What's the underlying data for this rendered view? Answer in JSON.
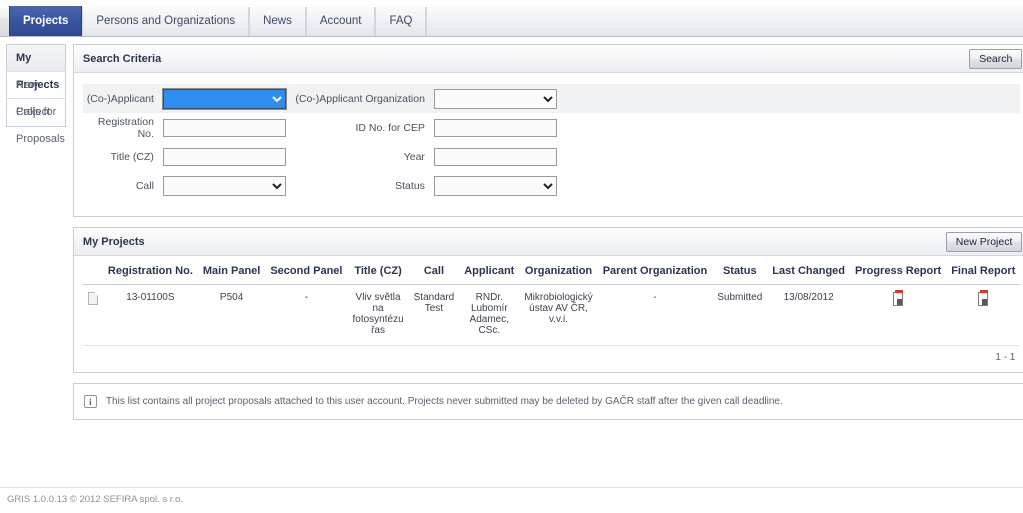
{
  "nav": {
    "tabs": [
      {
        "label": "Projects",
        "active": true
      },
      {
        "label": "Persons and Organizations",
        "active": false
      },
      {
        "label": "News",
        "active": false
      },
      {
        "label": "Account",
        "active": false
      },
      {
        "label": "FAQ",
        "active": false
      }
    ]
  },
  "sidebar": {
    "items": [
      {
        "label": "My Projects",
        "current": true
      },
      {
        "label": "New Project",
        "current": false
      },
      {
        "label": "Calls for Proposals",
        "current": false
      }
    ]
  },
  "search_panel": {
    "title": "Search Criteria",
    "search_button": "Search",
    "fields": {
      "applicant": {
        "label": "(Co-)Applicant",
        "value": "",
        "type": "select"
      },
      "applicant_org": {
        "label": "(Co-)Applicant Organization",
        "value": "",
        "type": "select"
      },
      "registration_no": {
        "label": "Registration No.",
        "value": "",
        "placeholder": ""
      },
      "id_no_cep": {
        "label": "ID No. for CEP",
        "value": "",
        "placeholder": ""
      },
      "title_cz": {
        "label": "Title (CZ)",
        "value": "",
        "placeholder": ""
      },
      "year": {
        "label": "Year",
        "value": "",
        "placeholder": ""
      },
      "call": {
        "label": "Call",
        "value": "",
        "type": "select"
      },
      "status": {
        "label": "Status",
        "value": "",
        "type": "select"
      }
    }
  },
  "projects_panel": {
    "title": "My Projects",
    "new_project_button": "New Project",
    "columns": [
      "Registration No.",
      "Main Panel",
      "Second Panel",
      "Title (CZ)",
      "Call",
      "Applicant",
      "Organization",
      "Parent Organization",
      "Status",
      "Last Changed",
      "Progress Report",
      "Final Report"
    ],
    "rows": [
      {
        "doc_icon": "page-icon",
        "registration_no": "13-01100S",
        "main_panel": "P504",
        "second_panel": "-",
        "title_cz": "Vliv světla na fotosyntézu řas",
        "call": "Standard Test",
        "applicant": "RNDr. Lubomír Adamec, CSc.",
        "organization": "Mikrobiologický ústav AV ČR, v.v.i.",
        "parent_organization": "-",
        "status": "Submitted",
        "last_changed": "13/08/2012",
        "progress_report": "report-icon",
        "final_report": "report-icon"
      }
    ],
    "pager": "1 - 1"
  },
  "notice": {
    "icon": "info-icon",
    "text": "This list contains all project proposals attached to this user account. Projects never submitted may be deleted by GAČR staff after the given call deadline."
  },
  "footer": {
    "text": "GRIS 1.0.0.13 © 2012 SEFIRA spol. s r.o."
  },
  "colors": {
    "active_tab": "#3a55a0",
    "focused_select": "#2d8ef0",
    "panel_border": "#c9cdd6",
    "report_icon_red": "#d03a2a"
  }
}
